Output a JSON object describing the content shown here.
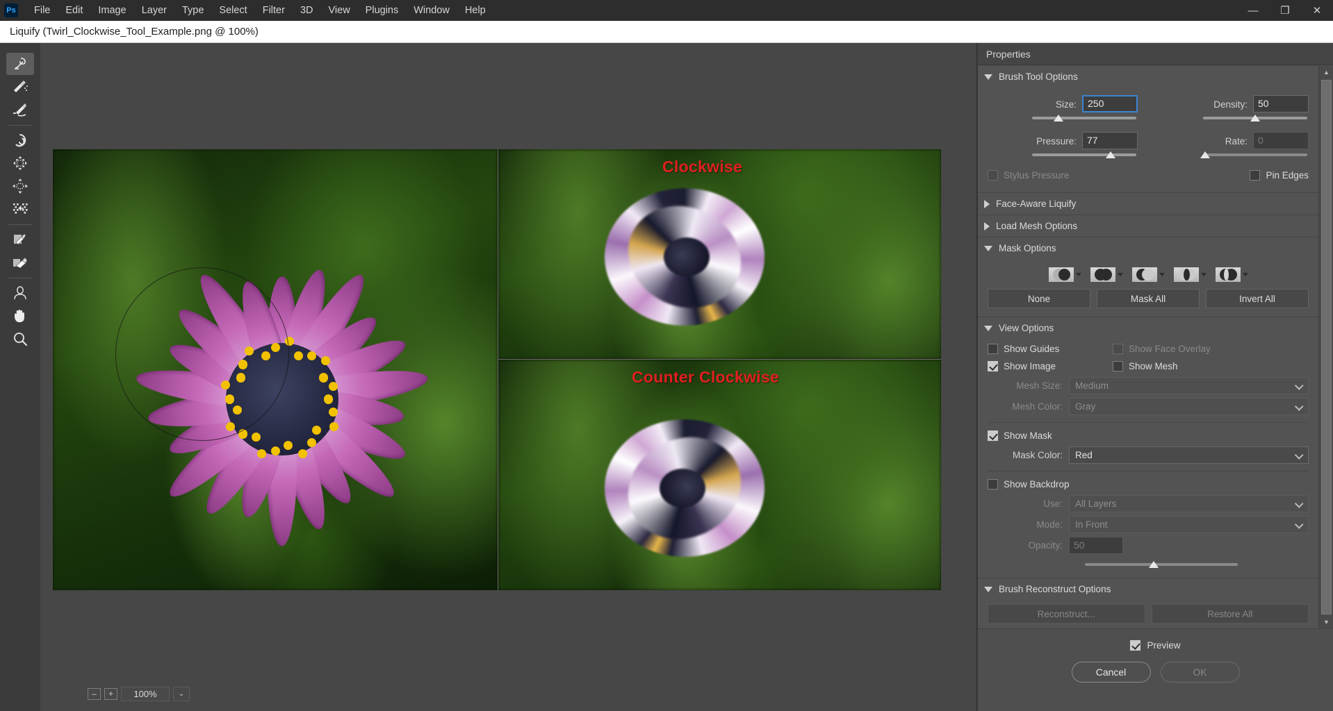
{
  "menubar": {
    "logo": "Ps",
    "items": [
      "File",
      "Edit",
      "Image",
      "Layer",
      "Type",
      "Select",
      "Filter",
      "3D",
      "View",
      "Plugins",
      "Window",
      "Help"
    ],
    "window_controls": {
      "minimize": "—",
      "restore": "❐",
      "close": "✕"
    }
  },
  "dialog": {
    "title": "Liquify (Twirl_Clockwise_Tool_Example.png @ 100%)"
  },
  "toolbar": {
    "tools": [
      {
        "name": "forward-warp-tool",
        "label": "Forward Warp Tool",
        "active": true
      },
      {
        "name": "reconstruct-tool",
        "label": "Reconstruct Tool",
        "active": false
      },
      {
        "name": "smooth-tool",
        "label": "Smooth Tool",
        "active": false
      },
      {
        "name": "twirl-clockwise-tool",
        "label": "Twirl Clockwise Tool",
        "active": false
      },
      {
        "name": "pucker-tool",
        "label": "Pucker Tool",
        "active": false
      },
      {
        "name": "bloat-tool",
        "label": "Bloat Tool",
        "active": false
      },
      {
        "name": "push-left-tool",
        "label": "Push Left Tool",
        "active": false
      },
      {
        "name": "freeze-mask-tool",
        "label": "Freeze Mask Tool",
        "active": false
      },
      {
        "name": "thaw-mask-tool",
        "label": "Thaw Mask Tool",
        "active": false
      },
      {
        "name": "face-tool",
        "label": "Face Tool",
        "active": false
      },
      {
        "name": "hand-tool",
        "label": "Hand Tool",
        "active": false
      },
      {
        "name": "zoom-tool",
        "label": "Zoom Tool",
        "active": false
      }
    ]
  },
  "canvas": {
    "labels": {
      "clockwise": "Clockwise",
      "counter_clockwise": "Counter Clockwise"
    },
    "label_color": "#e02020",
    "zoom": {
      "minus": "–",
      "plus": "+",
      "value": "100%",
      "caret": "⌄"
    }
  },
  "properties": {
    "header": "Properties",
    "brush_tool_options": {
      "title": "Brush Tool Options",
      "expanded": true,
      "size": {
        "label": "Size:",
        "value": "250",
        "focused": true,
        "slider_pct": 25
      },
      "density": {
        "label": "Density:",
        "value": "50",
        "focused": false,
        "slider_pct": 50
      },
      "pressure": {
        "label": "Pressure:",
        "value": "77",
        "focused": false,
        "slider_pct": 75
      },
      "rate": {
        "label": "Rate:",
        "value": "0",
        "disabled": true,
        "slider_pct": 2
      },
      "stylus_pressure": {
        "label": "Stylus Pressure",
        "checked": false,
        "disabled": true
      },
      "pin_edges": {
        "label": "Pin Edges",
        "checked": false,
        "disabled": false
      }
    },
    "face_aware_liquify": {
      "title": "Face-Aware Liquify",
      "expanded": false
    },
    "load_mesh_options": {
      "title": "Load Mesh Options",
      "expanded": false
    },
    "mask_options": {
      "title": "Mask Options",
      "expanded": true,
      "icons": [
        {
          "name": "mask-replace-selection-icon"
        },
        {
          "name": "mask-add-to-selection-icon"
        },
        {
          "name": "mask-subtract-from-selection-icon"
        },
        {
          "name": "mask-intersect-with-selection-icon"
        },
        {
          "name": "mask-invert-selection-icon"
        }
      ],
      "buttons": {
        "none": "None",
        "mask_all": "Mask All",
        "invert_all": "Invert All"
      }
    },
    "view_options": {
      "title": "View Options",
      "expanded": true,
      "show_guides": {
        "label": "Show Guides",
        "checked": false,
        "disabled": false
      },
      "show_face_overlay": {
        "label": "Show Face Overlay",
        "checked": false,
        "disabled": true
      },
      "show_image": {
        "label": "Show Image",
        "checked": true,
        "disabled": false
      },
      "show_mesh": {
        "label": "Show Mesh",
        "checked": false,
        "disabled": false
      },
      "mesh_size": {
        "label": "Mesh Size:",
        "value": "Medium",
        "disabled": true
      },
      "mesh_color": {
        "label": "Mesh Color:",
        "value": "Gray",
        "disabled": true
      },
      "show_mask": {
        "label": "Show Mask",
        "checked": true,
        "disabled": false
      },
      "mask_color": {
        "label": "Mask Color:",
        "value": "Red",
        "disabled": false
      },
      "show_backdrop": {
        "label": "Show Backdrop",
        "checked": false,
        "disabled": false
      },
      "use": {
        "label": "Use:",
        "value": "All Layers",
        "disabled": true
      },
      "mode": {
        "label": "Mode:",
        "value": "In Front",
        "disabled": true
      },
      "opacity": {
        "label": "Opacity:",
        "value": "50",
        "disabled": true,
        "slider_pct": 45
      }
    },
    "brush_reconstruct_options": {
      "title": "Brush Reconstruct Options",
      "expanded": true,
      "reconstruct": {
        "label": "Reconstruct...",
        "disabled": true
      },
      "restore_all": {
        "label": "Restore All",
        "disabled": true
      }
    },
    "footer": {
      "preview": {
        "label": "Preview",
        "checked": true
      },
      "cancel": {
        "label": "Cancel",
        "disabled": false
      },
      "ok": {
        "label": "OK",
        "disabled": true
      }
    }
  }
}
